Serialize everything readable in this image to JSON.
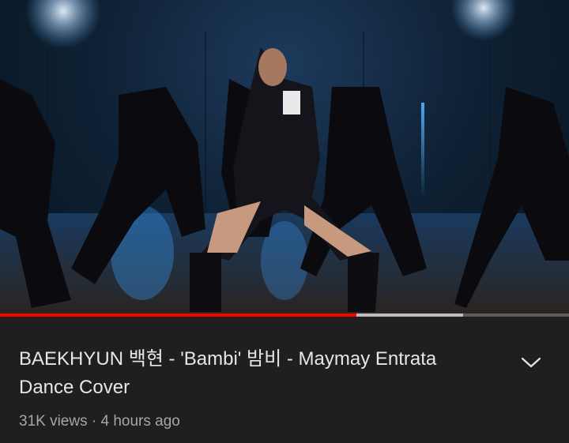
{
  "video": {
    "title_line1": "BAEKHYUN 백현 - 'Bambi' 밤비 - Maymay Entrata",
    "title_line2": "Dance Cover",
    "views": "31K views",
    "separator": "·",
    "posted": "4 hours ago",
    "thumbnail_description": "dance-studio-scene",
    "expand_icon": "chevron-down-icon"
  },
  "progress": {
    "played_fraction": 0.627,
    "buffered_fraction": 0.814
  },
  "colors": {
    "progress_played": "#ff0000",
    "background": "#1f1f1f",
    "title_text": "#e6e6e6",
    "meta_text": "#a6a6a6"
  }
}
